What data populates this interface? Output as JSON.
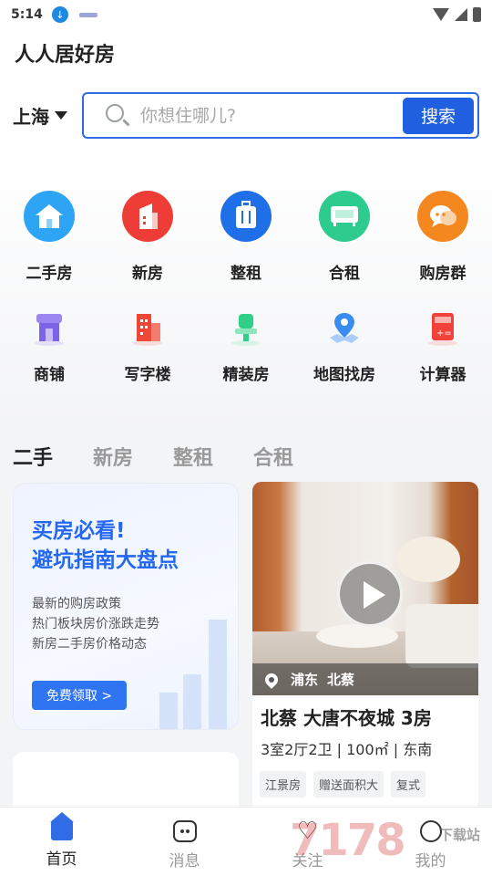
{
  "status": {
    "time": "5:14"
  },
  "app_title": "人人居好房",
  "search": {
    "city": "上海",
    "placeholder": "你想住哪儿?",
    "button": "搜索"
  },
  "categories_row1": [
    {
      "label": "二手房",
      "icon": "house-icon",
      "color": "#2ea4f5"
    },
    {
      "label": "新房",
      "icon": "building-icon",
      "color": "#ee3d36"
    },
    {
      "label": "整租",
      "icon": "luggage-icon",
      "color": "#1f6fe8"
    },
    {
      "label": "合租",
      "icon": "sofa-icon",
      "color": "#2dcc8e"
    },
    {
      "label": "购房群",
      "icon": "chat-icon",
      "color": "#f4871e"
    }
  ],
  "categories_row2": [
    {
      "label": "商铺",
      "icon": "shop-icon",
      "color": "#7c64e8"
    },
    {
      "label": "写字楼",
      "icon": "office-icon",
      "color": "#ee4637"
    },
    {
      "label": "精装房",
      "icon": "paint-roller-icon",
      "color": "#2fcf87"
    },
    {
      "label": "地图找房",
      "icon": "map-pin-icon",
      "color": "#3b8cf0"
    },
    {
      "label": "计算器",
      "icon": "calculator-icon",
      "color": "#f0413b"
    }
  ],
  "tabs": [
    "二手",
    "新房",
    "整租",
    "合租"
  ],
  "promo": {
    "title1": "买房必看!",
    "title2": "避坑指南大盘点",
    "lines": [
      "最新的购房政策",
      "热门板块房价涨跌走势",
      "新房二手房价格动态"
    ],
    "button": "免费领取 >"
  },
  "listing": {
    "district": "浦东",
    "area": "北蔡",
    "title": "北蔡 大唐不夜城 3房",
    "spec": "3室2厅2卫 | 100㎡ | 东南",
    "tags": [
      "江景房",
      "赠送面积大",
      "复式"
    ]
  },
  "nav": [
    {
      "label": "首页",
      "icon": "home-icon",
      "active": true
    },
    {
      "label": "消息",
      "icon": "message-icon",
      "active": false
    },
    {
      "label": "关注",
      "icon": "heart-icon",
      "active": false
    },
    {
      "label": "我的",
      "icon": "profile-icon",
      "active": false
    }
  ],
  "watermark": {
    "main": "7178",
    "sub": "下载站"
  }
}
